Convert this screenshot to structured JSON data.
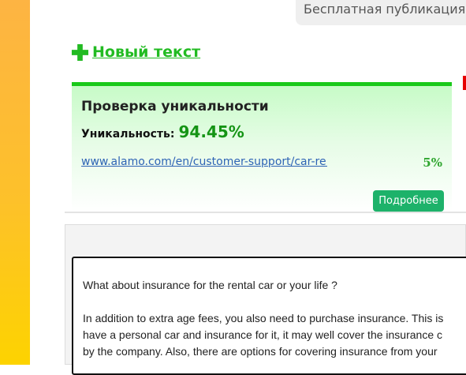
{
  "banner": {
    "text": "Бесплатная публикация н"
  },
  "new_text": {
    "label": "Новый текст",
    "icon": "plus-icon"
  },
  "check": {
    "title": "Проверка уникальности",
    "uniqueness_label": "Уникальность:",
    "uniqueness_value": "94.45%",
    "source_url": "www.alamo.com/en/customer-support/car-re...",
    "source_percent": "5%",
    "details_button": "Подробнее"
  },
  "editor": {
    "lines": [
      "What about insurance for the rental car or your life ?",
      "",
      "In addition to extra age fees, you also need to purchase insurance. This is",
      "have a personal car and insurance for it, it may well cover the insurance c",
      "by the company. Also, there are options for covering insurance from your"
    ]
  },
  "colors": {
    "stripe_top": "#fdb443",
    "stripe_bottom": "#fdd300",
    "accent_green": "#19c919",
    "button_green": "#1db26a",
    "value_green": "#159415",
    "link_blue": "#2e63b5"
  }
}
